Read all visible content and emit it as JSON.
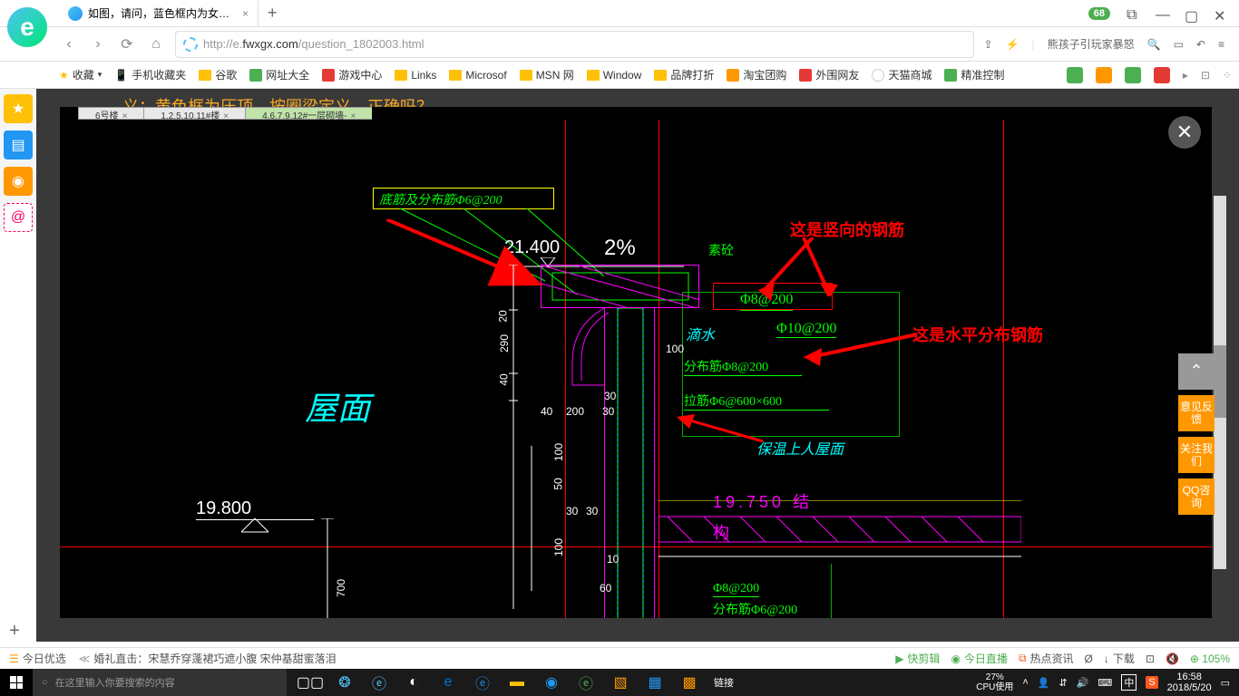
{
  "browser": {
    "tab_title": "如图，请问，蓝色框内为女儿墙",
    "url_prefix": "http://e.",
    "url_host": "fwxgx.com",
    "url_path": "/question_1802003.html",
    "badge": "68",
    "quick_text": "熊孩子引玩家暴怒"
  },
  "bookmarks": {
    "fav": "收藏",
    "items": [
      "手机收藏夹",
      "谷歌",
      "网址大全",
      "游戏中心",
      "Links",
      "Microsof",
      "MSN 网",
      "Window",
      "品牌打折",
      "淘宝团购",
      "外围网友",
      "天猫商城",
      "精准控制"
    ]
  },
  "page": {
    "partial_header": "义；黄色框为压顶，按圈梁定义，正确吗？"
  },
  "cad": {
    "tabs": [
      "6号楼",
      "1.2.5.10.11#楼",
      "4.6.7.9.12#一层砌墙-"
    ],
    "texts": {
      "box_label": "底筋及分布筋Φ6@200",
      "elev1": "21.400",
      "percent": "2%",
      "sutong": "素砼",
      "phi8_200": "Φ8@200",
      "dishui": "滴水",
      "phi10_200": "Φ10@200",
      "fenbu": "分布筋Φ8@200",
      "lajin": "拉筋Φ6@600×600",
      "baowen": "保温上人屋面",
      "wumian": "屋面",
      "elev2": "19.800",
      "jiegou_elev": "19.750",
      "jie": "结",
      "gou": "构",
      "phi8_200_b": "Φ8@200",
      "fenbu_b": "分布筋Φ6@200",
      "d20": "20",
      "d290": "290",
      "d40": "40",
      "d40b": "40",
      "d200": "200",
      "d30": "30",
      "d30b": "30",
      "d100": "100",
      "d50": "50",
      "d100b": "100",
      "d100c": "100",
      "d700": "700",
      "d10": "10",
      "d30c": "30",
      "d60": "60"
    },
    "annotations": {
      "vert_rebar": "这是竖向的钢筋",
      "horiz_rebar": "这是水平分布钢筋"
    }
  },
  "float": {
    "feedback": "意见反馈",
    "follow": "关注我们",
    "qq": "QQ咨询"
  },
  "promo": {
    "today": "今日优选",
    "news": "婚礼直击：宋慧乔穿蓬裙巧遮小腹 宋仲基甜蜜落泪",
    "items": [
      "快剪辑",
      "今日直播",
      "热点资讯",
      "",
      "下载",
      ""
    ],
    "zoom": "105%"
  },
  "taskbar": {
    "search_placeholder": "在这里输入你要搜索的内容",
    "link_label": "链接",
    "cpu_pct": "27%",
    "cpu_label": "CPU使用",
    "lang": "中",
    "time": "16:58",
    "date": "2018/5/20"
  }
}
